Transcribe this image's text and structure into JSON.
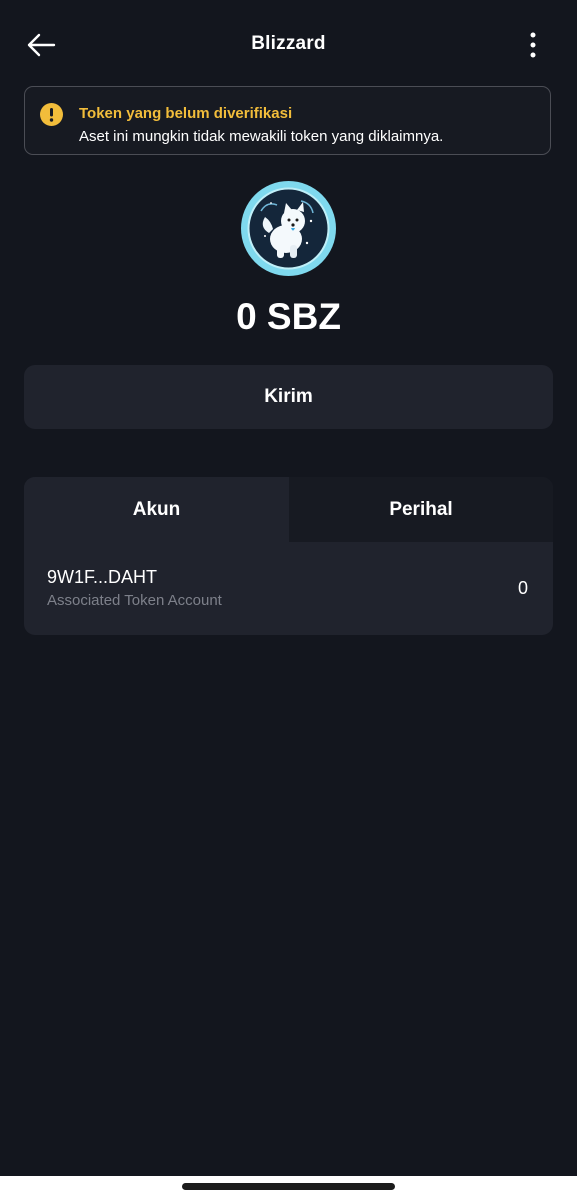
{
  "header": {
    "title": "Blizzard",
    "back_icon": "arrow-left-icon",
    "menu_icon": "more-vertical-icon"
  },
  "warning": {
    "icon": "exclamation-icon",
    "title": "Token yang belum diverifikasi",
    "message": "Aset ini mungkin tidak mewakili token yang diklaimnya.",
    "accent_color": "#f2bd3b"
  },
  "token": {
    "logo_icon": "samoyed-dog-token-logo",
    "balance": "0 SBZ"
  },
  "actions": {
    "send_label": "Kirim"
  },
  "tabs": [
    {
      "label": "Akun",
      "active": true
    },
    {
      "label": "Perihal",
      "active": false
    }
  ],
  "accounts": [
    {
      "address": "9W1F...DAHT",
      "type": "Associated Token Account",
      "amount": "0"
    }
  ]
}
